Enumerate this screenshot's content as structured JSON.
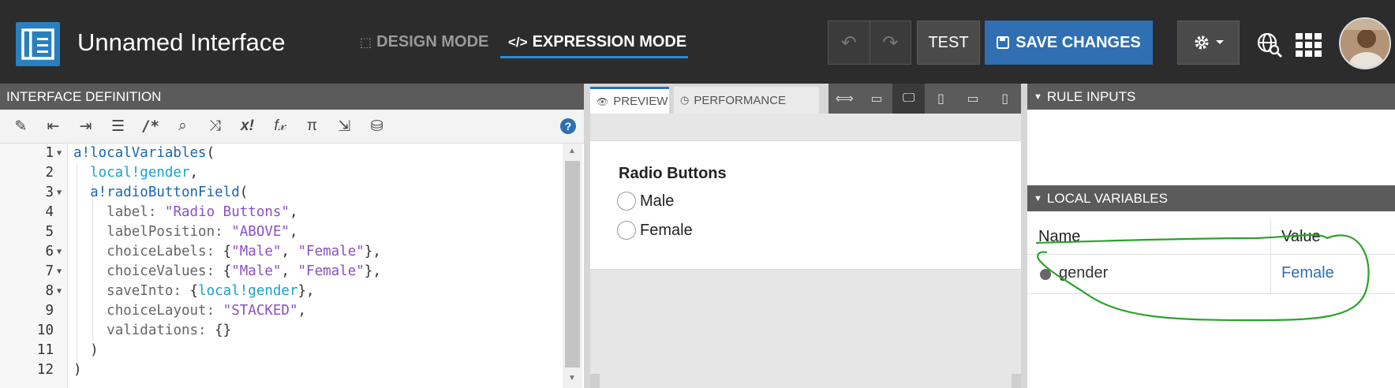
{
  "header": {
    "title": "Unnamed Interface",
    "design_mode": "DESIGN MODE",
    "expression_mode": "EXPRESSION MODE",
    "test_label": "TEST",
    "save_label": "SAVE CHANGES"
  },
  "left_panel": {
    "title": "INTERFACE DEFINITION",
    "help": "?",
    "toolbar_icons": [
      "wand-icon",
      "outdent-icon",
      "indent-icon",
      "list-icon",
      "comment-icon",
      "search-icon",
      "shuffle-icon",
      "x-icon",
      "function-icon",
      "pi-icon",
      "export-icon",
      "database-search-icon"
    ],
    "line_numbers": [
      "1",
      "2",
      "3",
      "4",
      "5",
      "6",
      "7",
      "8",
      "9",
      "10",
      "11",
      "12"
    ]
  },
  "preview": {
    "tab_preview": "PREVIEW",
    "tab_performance": "PERFORMANCE",
    "field_label": "Radio Buttons",
    "options": [
      "Male",
      "Female"
    ]
  },
  "right_panel": {
    "rule_inputs": "RULE INPUTS",
    "local_variables": "LOCAL VARIABLES",
    "col_name": "Name",
    "col_value": "Value",
    "var_name": "gender",
    "var_value": "Female",
    "value_color": "#2f6fb2",
    "annotation_color": "#2aa22a"
  }
}
